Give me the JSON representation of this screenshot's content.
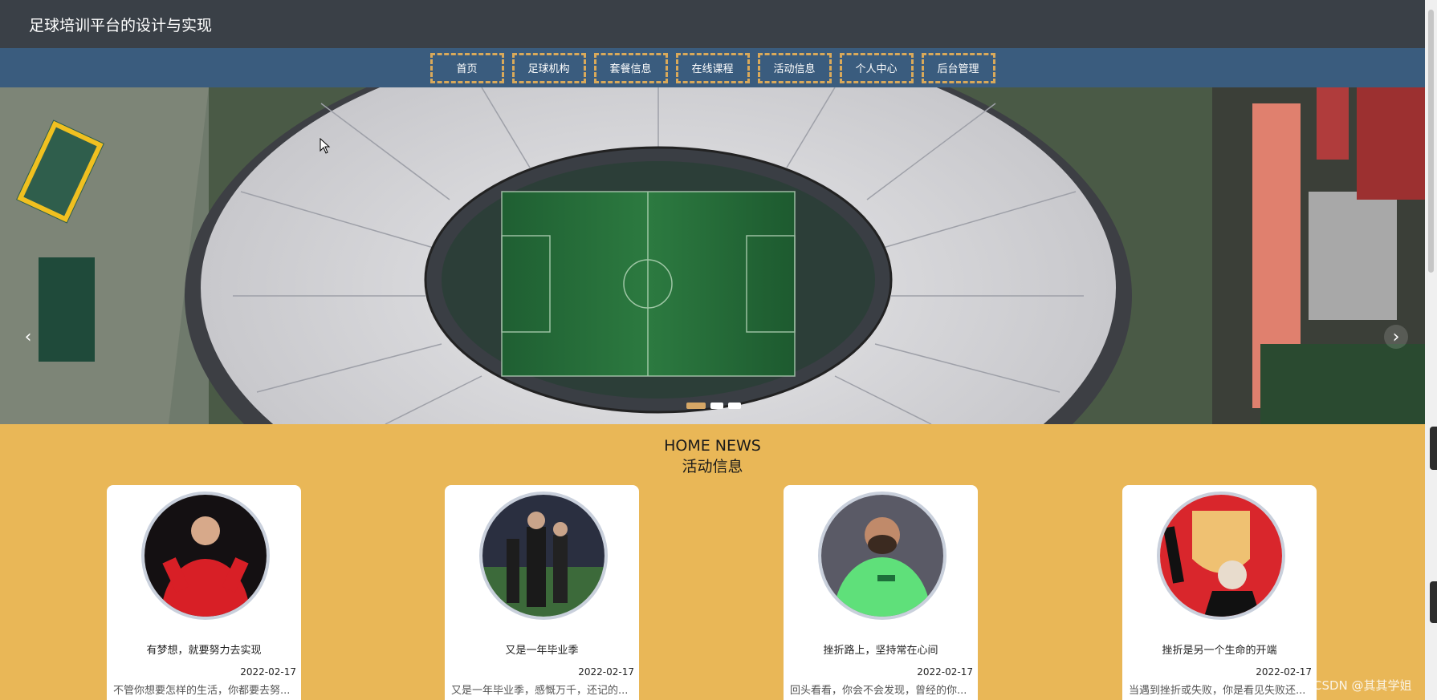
{
  "header": {
    "title": "足球培训平台的设计与实现"
  },
  "nav": {
    "items": [
      {
        "label": "首页"
      },
      {
        "label": "足球机构"
      },
      {
        "label": "套餐信息"
      },
      {
        "label": "在线课程"
      },
      {
        "label": "活动信息"
      },
      {
        "label": "个人中心"
      },
      {
        "label": "后台管理"
      }
    ]
  },
  "banner": {
    "prev_icon": "chevron-left-icon",
    "next_icon": "chevron-right-icon",
    "slides": 3,
    "active_slide": 1
  },
  "news": {
    "heading_en": "HOME NEWS",
    "heading_cn": "活动信息",
    "cards": [
      {
        "title": "有梦想，就要努力去实现",
        "date": "2022-02-17",
        "desc": "不管你想要怎样的生活，你都要去努..."
      },
      {
        "title": "又是一年毕业季",
        "date": "2022-02-17",
        "desc": "又是一年毕业季，感慨万千，还记的..."
      },
      {
        "title": "挫折路上，坚持常在心间",
        "date": "2022-02-17",
        "desc": "回头看看，你会不会发现，曾经的你..."
      },
      {
        "title": "挫折是另一个生命的开端",
        "date": "2022-02-17",
        "desc": "当遇到挫折或失败，你是看见失败还..."
      }
    ]
  },
  "watermark": "CSDN @其其学姐",
  "colors": {
    "topbar": "#3a4047",
    "navbar": "#3a5c7e",
    "nav_border": "#d9a95a",
    "section_bg": "#e9b757"
  }
}
